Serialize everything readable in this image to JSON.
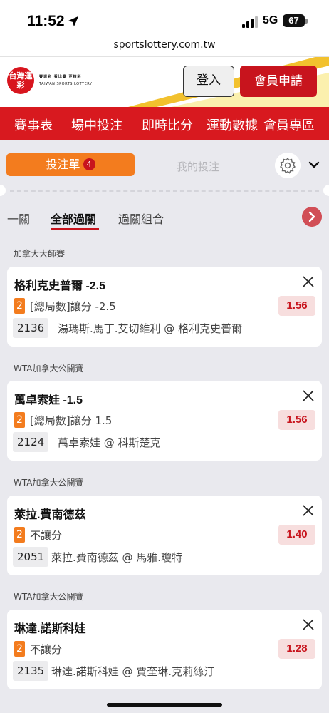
{
  "status_bar": {
    "time": "11:52",
    "network": "5G",
    "battery": "67"
  },
  "browser": {
    "url": "sportslottery.com.tw"
  },
  "header": {
    "logo_mark": "台灣運彩",
    "logo_line1": "賽運彩 看比賽 更精彩",
    "logo_line2": "TAIWAN SPORTS LOTTERY",
    "login_label": "登入",
    "register_label": "會員申請"
  },
  "nav": {
    "items": [
      "賽事表",
      "場中投注",
      "即時比分",
      "運動數據",
      "會員專區"
    ]
  },
  "betslip": {
    "tab_betslip": "投注單",
    "betslip_count": "4",
    "tab_my_bets": "我的投注",
    "type_tabs": [
      "一關",
      "全部過關",
      "過關組合"
    ],
    "active_type_tab": "全部過關"
  },
  "bets": [
    {
      "league": "加拿大大師賽",
      "title": "格利克史普爾 -2.5",
      "pick_number": "2",
      "market": "[總局數]讓分 -2.5",
      "odds": "1.56",
      "code": "2136",
      "match": "湯瑪斯.馬丁.艾切維利 @ 格利克史普爾"
    },
    {
      "league": "WTA加拿大公開賽",
      "title": "萬卓索娃 -1.5",
      "pick_number": "2",
      "market": "[總局數]讓分 1.5",
      "odds": "1.56",
      "code": "2124",
      "match": "萬卓索娃 @ 科斯楚克"
    },
    {
      "league": "WTA加拿大公開賽",
      "title": "萊拉.費南德茲",
      "pick_number": "2",
      "market": "不讓分",
      "odds": "1.40",
      "code": "2051",
      "match": "萊拉.費南德茲 @ 馬雅.瓊特"
    },
    {
      "league": "WTA加拿大公開賽",
      "title": "琳達.諾斯科娃",
      "pick_number": "2",
      "market": "不讓分",
      "odds": "1.28",
      "code": "2135",
      "match": "琳達.諾斯科娃 @ 賈奎琳.克莉絲汀"
    }
  ],
  "colors": {
    "brand_red": "#d8191f",
    "accent_orange": "#f37c1e",
    "odds_bg": "#f7dede"
  },
  "icons": [
    "location-arrow-icon",
    "signal-icon",
    "battery-icon",
    "gear-icon",
    "chevron-down-icon",
    "chevron-right-icon",
    "close-icon"
  ]
}
